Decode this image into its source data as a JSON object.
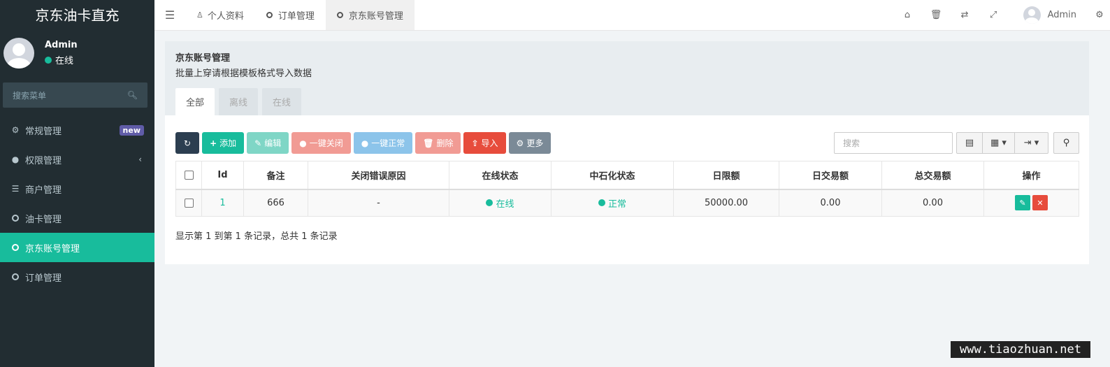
{
  "brand": "京东油卡直充",
  "user": {
    "name": "Admin",
    "status": "在线"
  },
  "sidebar": {
    "search_placeholder": "搜索菜单",
    "items": [
      {
        "label": "常规管理",
        "icon": "cogs-icon",
        "badge": "new"
      },
      {
        "label": "权限管理",
        "icon": "group-icon",
        "chevron": "‹"
      },
      {
        "label": "商户管理",
        "icon": "list-icon"
      },
      {
        "label": "油卡管理",
        "icon": "circle-icon"
      },
      {
        "label": "京东账号管理",
        "icon": "circle-icon",
        "active": true
      },
      {
        "label": "订单管理",
        "icon": "circle-icon"
      }
    ]
  },
  "header": {
    "tabs": [
      {
        "label": "个人资料",
        "icon": "user-icon"
      },
      {
        "label": "订单管理",
        "icon": "circle-icon"
      },
      {
        "label": "京东账号管理",
        "icon": "circle-icon",
        "active": true
      }
    ],
    "admin_name": "Admin",
    "icons": [
      "home-icon",
      "trash-icon",
      "translate-icon",
      "fullscreen-icon",
      "settings-icon"
    ]
  },
  "panel": {
    "title": "京东账号管理",
    "subtitle": "批量上穿请根据模板格式导入数据",
    "tabs": [
      {
        "label": "全部",
        "active": true
      },
      {
        "label": "离线"
      },
      {
        "label": "在线"
      }
    ]
  },
  "toolbar": {
    "add": "添加",
    "edit": "编辑",
    "close_all": "一键关闭",
    "normal_all": "一键正常",
    "delete": "删除",
    "import": "导入",
    "more": "更多",
    "search_placeholder": "搜索"
  },
  "table": {
    "headers": [
      "Id",
      "备注",
      "关闭错误原因",
      "在线状态",
      "中石化状态",
      "日限额",
      "日交易额",
      "总交易额",
      "操作"
    ],
    "rows": [
      {
        "id": "1",
        "remark": "666",
        "close_reason": "-",
        "online": "在线",
        "sinopec": "正常",
        "daily_limit": "50000.00",
        "daily_amount": "0.00",
        "total_amount": "0.00"
      }
    ]
  },
  "pager_info": "显示第 1 到第 1 条记录，总共 1 条记录",
  "watermark": "www.tiaozhuan.net"
}
